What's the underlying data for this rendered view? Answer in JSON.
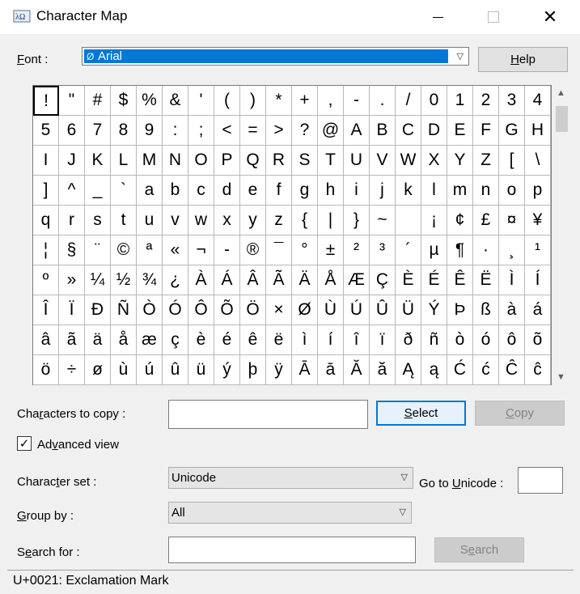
{
  "window": {
    "title": "Character Map",
    "close_glyph": "✕"
  },
  "font": {
    "label_key": "F",
    "label_rest": "ont :",
    "selected": "Arial",
    "help_key": "H",
    "help_rest": "elp"
  },
  "grid": {
    "rows": [
      [
        "!",
        "\"",
        "#",
        "$",
        "%",
        "&",
        "'",
        "(",
        ")",
        "*",
        "+",
        ",",
        "-",
        ".",
        "/",
        "0",
        "1",
        "2",
        "3",
        "4"
      ],
      [
        "5",
        "6",
        "7",
        "8",
        "9",
        ":",
        ";",
        "<",
        "=",
        ">",
        "?",
        "@",
        "A",
        "B",
        "C",
        "D",
        "E",
        "F",
        "G",
        "H"
      ],
      [
        "I",
        "J",
        "K",
        "L",
        "M",
        "N",
        "O",
        "P",
        "Q",
        "R",
        "S",
        "T",
        "U",
        "V",
        "W",
        "X",
        "Y",
        "Z",
        "[",
        "\\"
      ],
      [
        "]",
        "^",
        "_",
        "`",
        "a",
        "b",
        "c",
        "d",
        "e",
        "f",
        "g",
        "h",
        "i",
        "j",
        "k",
        "l",
        "m",
        "n",
        "o",
        "p"
      ],
      [
        "q",
        "r",
        "s",
        "t",
        "u",
        "v",
        "w",
        "x",
        "y",
        "z",
        "{",
        "|",
        "}",
        "~",
        "",
        "¡",
        "¢",
        "£",
        "¤",
        "¥"
      ],
      [
        "¦",
        "§",
        "¨",
        "©",
        "ª",
        "«",
        "¬",
        "-",
        "®",
        "¯",
        "°",
        "±",
        "²",
        "³",
        "´",
        "µ",
        "¶",
        "·",
        "¸",
        "¹"
      ],
      [
        "º",
        "»",
        "¼",
        "½",
        "¾",
        "¿",
        "À",
        "Á",
        "Â",
        "Ã",
        "Ä",
        "Å",
        "Æ",
        "Ç",
        "È",
        "É",
        "Ê",
        "Ë",
        "Ì",
        "Í"
      ],
      [
        "Î",
        "Ï",
        "Ð",
        "Ñ",
        "Ò",
        "Ó",
        "Ô",
        "Õ",
        "Ö",
        "×",
        "Ø",
        "Ù",
        "Ú",
        "Û",
        "Ü",
        "Ý",
        "Þ",
        "ß",
        "à",
        "á"
      ],
      [
        "â",
        "ã",
        "ä",
        "å",
        "æ",
        "ç",
        "è",
        "é",
        "ê",
        "ë",
        "ì",
        "í",
        "î",
        "ï",
        "ð",
        "ñ",
        "ò",
        "ó",
        "ô",
        "õ"
      ],
      [
        "ö",
        "÷",
        "ø",
        "ù",
        "ú",
        "û",
        "ü",
        "ý",
        "þ",
        "ÿ",
        "Ā",
        "ā",
        "Ă",
        "ă",
        "Ą",
        "ą",
        "Ć",
        "ć",
        "Ĉ",
        "ĉ"
      ]
    ],
    "selected_char": "!"
  },
  "copy_row": {
    "label_pre": "Cha",
    "label_key": "r",
    "label_post": "acters to copy :",
    "value": "",
    "select_key": "S",
    "select_rest": "elect",
    "copy_key": "C",
    "copy_rest": "opy"
  },
  "advanced": {
    "pre": "Ad",
    "key": "v",
    "post": "anced view",
    "checked": true,
    "check_glyph": "✓"
  },
  "charset": {
    "pre": "Charac",
    "key": "t",
    "post": "er set :",
    "value": "Unicode",
    "goto_pre": "Go to ",
    "goto_key": "U",
    "goto_post": "nicode :",
    "goto_value": ""
  },
  "groupby": {
    "key": "G",
    "rest": "roup by :",
    "value": "All"
  },
  "search": {
    "pre": "S",
    "key": "e",
    "post": "arch for :",
    "value": "",
    "btn_pre": "S",
    "btn_key": "e",
    "btn_post": "arch"
  },
  "status": {
    "text": "U+0021: Exclamation Mark"
  }
}
